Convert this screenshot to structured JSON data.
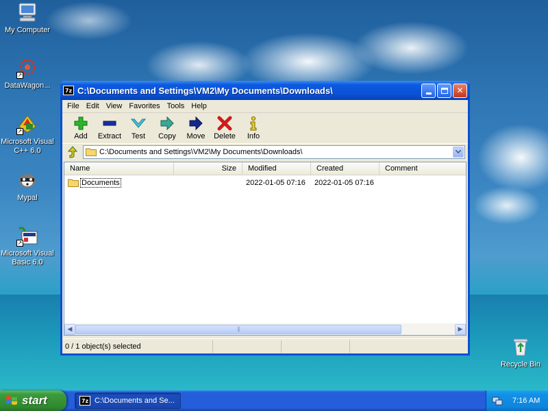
{
  "desktop": {
    "icons": [
      {
        "label": "My Computer",
        "icon": "my-computer-icon"
      },
      {
        "label": "DataWagon...",
        "icon": "datawagon-icon"
      },
      {
        "label": "Microsoft Visual C++ 6.0",
        "icon": "visual-cpp-icon"
      },
      {
        "label": "Mypal",
        "icon": "mypal-icon"
      },
      {
        "label": "Microsoft Visual Basic 6.0",
        "icon": "visual-basic-icon"
      },
      {
        "label": "Recycle Bin",
        "icon": "recycle-bin-icon"
      }
    ]
  },
  "window": {
    "title": "C:\\Documents and Settings\\VM2\\My Documents\\Downloads\\",
    "app_icon_text": "7z",
    "menu": [
      "File",
      "Edit",
      "View",
      "Favorites",
      "Tools",
      "Help"
    ],
    "toolbar": [
      {
        "label": "Add",
        "icon": "add-icon",
        "color": "#1aa01a"
      },
      {
        "label": "Extract",
        "icon": "extract-icon",
        "color": "#1a2fa0"
      },
      {
        "label": "Test",
        "icon": "test-icon",
        "color": "#2ab0c8"
      },
      {
        "label": "Copy",
        "icon": "copy-icon",
        "color": "#2a9a8a"
      },
      {
        "label": "Move",
        "icon": "move-icon",
        "color": "#142a8a"
      },
      {
        "label": "Delete",
        "icon": "delete-icon",
        "color": "#d01a1a"
      },
      {
        "label": "Info",
        "icon": "info-icon",
        "color": "#d8c020"
      }
    ],
    "address": "C:\\Documents and Settings\\VM2\\My Documents\\Downloads\\",
    "columns": [
      "Name",
      "Size",
      "Modified",
      "Created",
      "Comment"
    ],
    "rows": [
      {
        "name": "Documents",
        "size": "",
        "modified": "2022-01-05 07:16",
        "created": "2022-01-05 07:16",
        "comment": ""
      }
    ],
    "scroll_grip": "|||",
    "status": {
      "selection": "0 / 1 object(s) selected",
      "pane2": "",
      "pane3": "",
      "pane4": ""
    }
  },
  "taskbar": {
    "start_label": "start",
    "task_label": "C:\\Documents and Se...",
    "task_icon_text": "7z",
    "clock": "7:16 AM"
  }
}
